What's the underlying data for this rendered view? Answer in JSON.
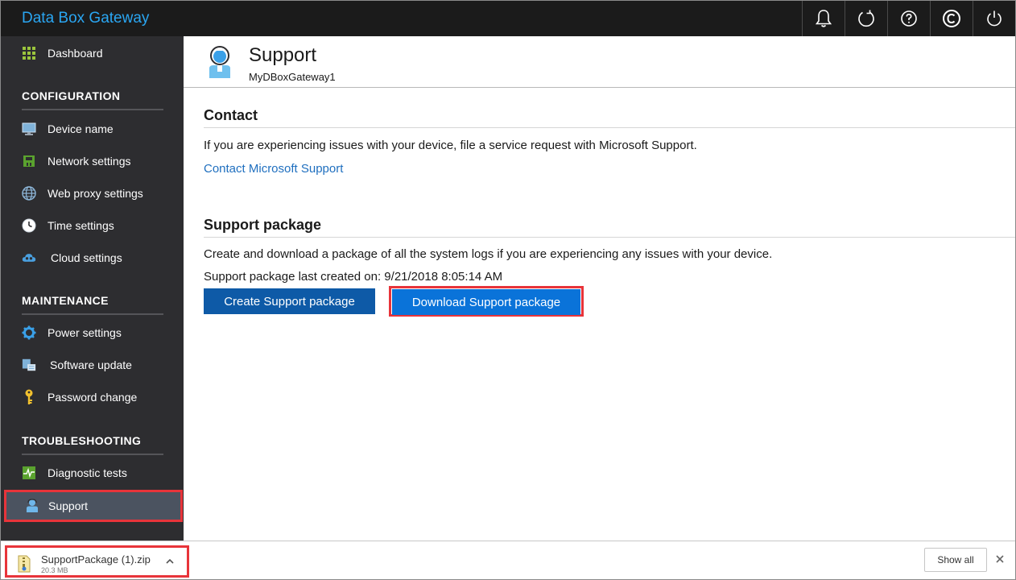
{
  "app": {
    "title": "Data Box Gateway"
  },
  "topbar": {
    "icons": [
      "bell-icon",
      "refresh-icon",
      "help-icon",
      "copyright-icon",
      "power-icon"
    ]
  },
  "sidebar": {
    "dashboard": {
      "label": "Dashboard",
      "icon": "dashboard-grid-icon"
    },
    "sections": {
      "configuration": "CONFIGURATION",
      "maintenance": "MAINTENANCE",
      "troubleshooting": "TROUBLESHOOTING"
    },
    "items": {
      "device_name": {
        "label": "Device name",
        "icon": "monitor-icon"
      },
      "network_settings": {
        "label": "Network settings",
        "icon": "network-icon"
      },
      "web_proxy_settings": {
        "label": "Web proxy settings",
        "icon": "globe-icon"
      },
      "time_settings": {
        "label": "Time settings",
        "icon": "clock-icon"
      },
      "cloud_settings": {
        "label": "Cloud settings",
        "icon": "cloud-icon"
      },
      "power_settings": {
        "label": "Power settings",
        "icon": "gear-icon"
      },
      "software_update": {
        "label": "Software update",
        "icon": "update-icon"
      },
      "password_change": {
        "label": "Password change",
        "icon": "key-icon"
      },
      "diagnostic_tests": {
        "label": "Diagnostic tests",
        "icon": "pulse-icon"
      },
      "support": {
        "label": "Support",
        "icon": "support-person-icon",
        "selected": true
      }
    }
  },
  "page": {
    "title": "Support",
    "subtitle": "MyDBoxGateway1",
    "contact": {
      "heading": "Contact",
      "text": "If you are experiencing issues with your device, file a service request with Microsoft Support.",
      "link": "Contact Microsoft Support"
    },
    "support_package": {
      "heading": "Support package",
      "text": "Create and download a package of all the system logs if you are experiencing any issues with your device.",
      "last_created": "Support package last created on: 9/21/2018 8:05:14 AM",
      "create_button": "Create Support package",
      "download_button": "Download Support package"
    }
  },
  "download_bar": {
    "file_name": "SupportPackage (1).zip",
    "file_size": "20.3 MB",
    "show_all": "Show all"
  },
  "colors": {
    "accent": "#2aa6f2",
    "sidebar_bg": "#2d2d30",
    "topbar_bg": "#1b1b1b",
    "button_primary": "#0e5aa7",
    "button_active": "#0a73d9",
    "highlight": "#e8343a",
    "link": "#1f6fbf"
  }
}
